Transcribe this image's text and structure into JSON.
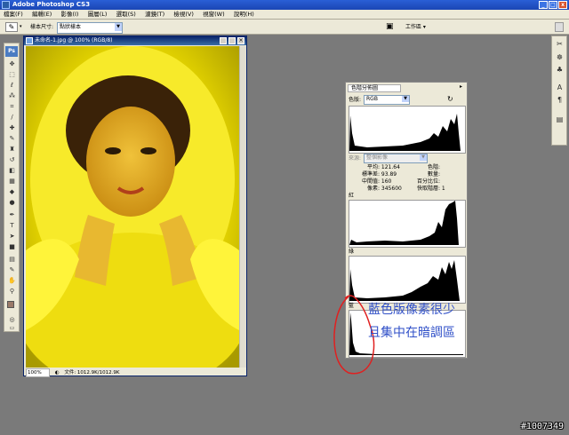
{
  "app": {
    "title": "Adobe Photoshop CS3"
  },
  "menu": [
    "檔案(F)",
    "編輯(E)",
    "影像(I)",
    "圖層(L)",
    "選取(S)",
    "濾鏡(T)",
    "檢視(V)",
    "視窗(W)",
    "說明(H)"
  ],
  "options": {
    "sample_label": "樣本尺寸:",
    "sample_value": "點狀樣本",
    "workspace": "工作區 ▾"
  },
  "document": {
    "title": "未命名-1.jpg @ 100% (RGB/8)",
    "zoom": "100%",
    "file_info": "文件: 1012.9K/1012.9K"
  },
  "histogram": {
    "tab": "色階分佈圖",
    "channel_label": "色版:",
    "channel_value": "RGB",
    "source_label": "來源:",
    "source_value": "整個影像",
    "stats_left": [
      {
        "label": "平均:",
        "value": "121.64"
      },
      {
        "label": "標準差:",
        "value": "93.89"
      },
      {
        "label": "中間值:",
        "value": "160"
      },
      {
        "label": "像素:",
        "value": "345600"
      }
    ],
    "stats_right": [
      {
        "label": "色階:",
        "value": ""
      },
      {
        "label": "數量:",
        "value": ""
      },
      {
        "label": "百分比位:",
        "value": ""
      },
      {
        "label": "快取階層:",
        "value": "1"
      }
    ],
    "red_label": "紅",
    "green_label": "綠",
    "blue_label": "藍"
  },
  "annotation": {
    "line1": "藍色版像素很少",
    "line2": "且集中在暗調區",
    "color": "#3050c8"
  },
  "watermark": "#1007349",
  "colors": {
    "foreground": "#9a7a6a",
    "background": "#c8a89a"
  }
}
